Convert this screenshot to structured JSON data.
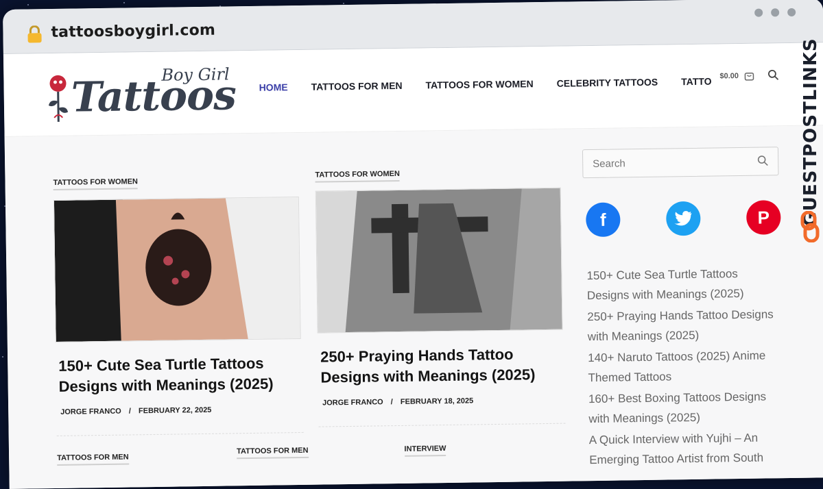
{
  "browser": {
    "url": "tattoosboygirl.com"
  },
  "logo": {
    "word": "Tattoos",
    "sub": "Boy Girl"
  },
  "nav": {
    "items": [
      {
        "label": "HOME",
        "active": true
      },
      {
        "label": "TATTOOS FOR MEN"
      },
      {
        "label": "TATTOOS FOR WOMEN"
      },
      {
        "label": "CELEBRITY TATTOOS"
      },
      {
        "label": "TATTOO"
      }
    ],
    "cart_amount": "$0.00"
  },
  "posts": [
    {
      "category": "TATTOOS FOR WOMEN",
      "title": "150+ Cute Sea Turtle Tattoos Designs with Meanings (2025)",
      "author": "JORGE FRANCO",
      "separator": "/",
      "date": "FEBRUARY 22, 2025"
    },
    {
      "category": "TATTOOS FOR WOMEN",
      "title": "250+ Praying Hands Tattoo Designs with Meanings (2025)",
      "author": "JORGE FRANCO",
      "separator": "/",
      "date": "FEBRUARY 18, 2025"
    }
  ],
  "lower_categories": [
    "TATTOOS FOR MEN",
    "TATTOOS FOR MEN",
    "INTERVIEW"
  ],
  "sidebar": {
    "search_placeholder": "Search",
    "socials": [
      {
        "name": "facebook",
        "glyph": "f",
        "color": "#1877f2"
      },
      {
        "name": "twitter",
        "glyph": "t",
        "color": "#1da1f2"
      },
      {
        "name": "pinterest",
        "glyph": "P",
        "color": "#e60023"
      }
    ],
    "recent": [
      "150+ Cute Sea Turtle Tattoos Designs with Meanings (2025)",
      "250+ Praying Hands Tattoo Designs with Meanings (2025)",
      "140+ Naruto Tattoos (2025) Anime Themed Tattoos",
      "160+ Best Boxing Tattoos Designs with Meanings (2025)",
      "A Quick Interview with Yujhi – An Emerging Tattoo Artist from South"
    ]
  },
  "watermark": {
    "text": "GUESTPOSTLINKS"
  },
  "colors": {
    "nav_active": "#3b3fa8",
    "logo": "#38404e",
    "watermark_accent": "#f26b2b"
  }
}
